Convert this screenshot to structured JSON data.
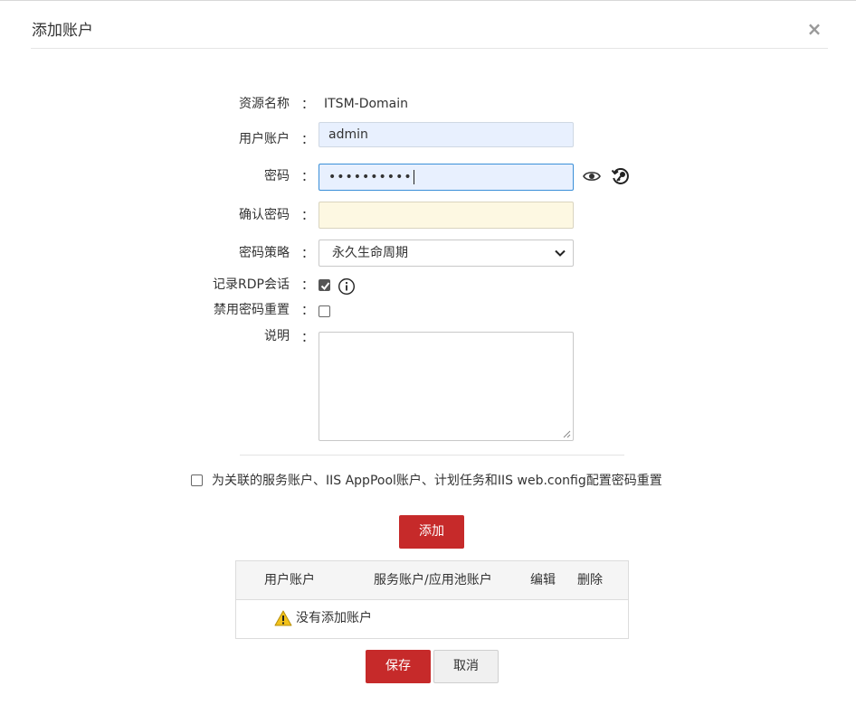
{
  "dialog": {
    "title": "添加账户",
    "close_glyph": "×"
  },
  "form": {
    "colon": "：",
    "resource_name": {
      "label": "资源名称",
      "value": "ITSM-Domain"
    },
    "user_account": {
      "label": "用户账户",
      "value": "admin"
    },
    "password": {
      "label": "密码",
      "masked_value": "••••••••••"
    },
    "confirm_password": {
      "label": "确认密码",
      "value": ""
    },
    "password_policy": {
      "label": "密码策略",
      "selected": "永久生命周期"
    },
    "record_rdp": {
      "label": "记录RDP会话",
      "checked": true
    },
    "disable_pwd_reset": {
      "label": "禁用密码重置",
      "checked": false
    },
    "description": {
      "label": "说明",
      "value": ""
    }
  },
  "reset_option": {
    "label": "为关联的服务账户、IIS AppPool账户、计划任务和IIS web.config配置密码重置",
    "checked": false
  },
  "buttons": {
    "add": "添加",
    "save": "保存",
    "cancel": "取消"
  },
  "table": {
    "columns": [
      "用户账户",
      "服务账户/应用池账户",
      "编辑",
      "删除"
    ],
    "empty_message": "没有添加账户"
  },
  "icons": {
    "eye": "eye-icon",
    "key": "key-reset-icon",
    "info": "info-icon",
    "warning": "warning-icon"
  },
  "colors": {
    "primary_red": "#c62a2a",
    "autofill_blue": "#e8f0fe",
    "focus_border": "#3a8fd8",
    "confirm_bg": "#fdf8e2"
  }
}
